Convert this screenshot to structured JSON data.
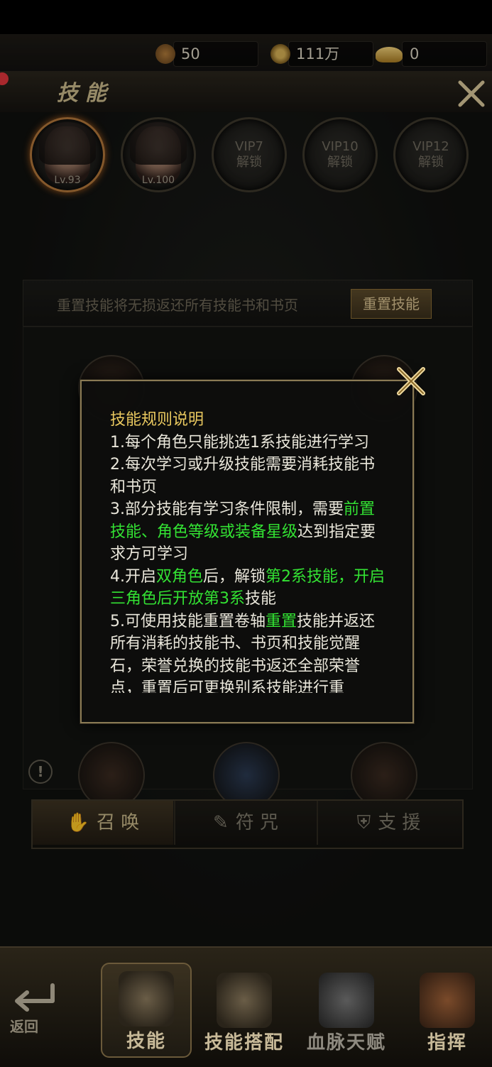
{
  "currency": {
    "tokens": "50",
    "coins": "111万",
    "ingots": "0"
  },
  "header": {
    "title": "技能"
  },
  "characters": [
    {
      "level": "Lv.93"
    },
    {
      "level": "Lv.100"
    },
    {
      "vip": "VIP7",
      "lock": "解锁"
    },
    {
      "vip": "VIP10",
      "lock": "解锁"
    },
    {
      "vip": "VIP12",
      "lock": "解锁"
    }
  ],
  "reset": {
    "hint": "重置技能将无损返还所有技能书和书页",
    "button": "重置技能"
  },
  "tabs": [
    {
      "label": "召 唤"
    },
    {
      "label": "符 咒"
    },
    {
      "label": "支 援"
    }
  ],
  "dialog": {
    "title": "技能规则说明",
    "rule1": "1.每个角色只能挑选1系技能进行学习",
    "rule2": "2.每次学习或升级技能需要消耗技能书和书页",
    "rule3_a": "3.部分技能有学习条件限制，需要",
    "rule3_b": "前置技能、角色等级或装备星级",
    "rule3_c": "达到指定要求方可学习",
    "rule4_a": "4.开启",
    "rule4_b": "双角色",
    "rule4_c": "后，解锁",
    "rule4_d": "第2系技能，开启三角色后开放第3系",
    "rule4_e": "技能",
    "rule5_a": "5.可使用技能重置卷轴",
    "rule5_b": "重置",
    "rule5_c": "技能并返还所有消耗的技能书、书页和技能觉醒石，荣誉兑换的技能书返还全部荣誉点，重置后可更换别系技能进行重"
  },
  "bottom_nav": {
    "back": "返回",
    "items": [
      {
        "label": "技能"
      },
      {
        "label": "技能搭配"
      },
      {
        "label": "血脉天赋"
      },
      {
        "label": "指挥"
      }
    ]
  },
  "colors": {
    "highlight": "#33e233",
    "title_gold": "#e9c85f",
    "frame_gold": "#8a7a54"
  }
}
